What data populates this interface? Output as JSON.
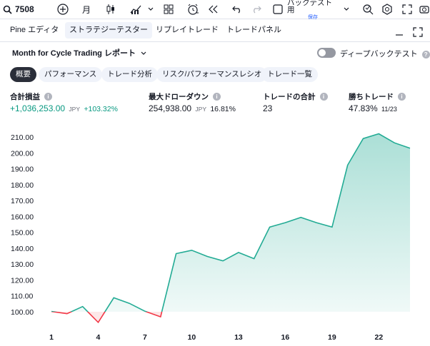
{
  "toolbar": {
    "symbol": "7508",
    "interval": "月",
    "layout_name": "バックテスト用",
    "save_state": "保存"
  },
  "tabs": [
    {
      "label": "Pine エディタ"
    },
    {
      "label": "ストラテジーテスター"
    },
    {
      "label": "リプレイトレード"
    },
    {
      "label": "トレードパネル"
    }
  ],
  "report": {
    "title": "Month for Cycle Trading レポート",
    "deep_backtest_label": "ディープバックテスト"
  },
  "subtabs": [
    {
      "label": "概要"
    },
    {
      "label": "パフォーマンス"
    },
    {
      "label": "トレード分析"
    },
    {
      "label": "リスク/パフォーマンスレシオ"
    },
    {
      "label": "トレード一覧"
    }
  ],
  "stats": {
    "net_profit": {
      "label": "合計損益",
      "value": "+1,036,253.00",
      "unit": "JPY",
      "pct": "+103.32%"
    },
    "max_drawdown": {
      "label": "最大ドローダウン",
      "value": "254,938.00",
      "unit": "JPY",
      "pct": "16.81%"
    },
    "total_trades": {
      "label": "トレードの合計",
      "value": "23"
    },
    "win_rate": {
      "label": "勝ちトレード",
      "value": "47.83%",
      "detail": "11/23"
    }
  },
  "colors": {
    "accent_green": "#089981",
    "line_green": "#22ab94",
    "loss_red": "#f23645"
  },
  "chart_data": {
    "type": "area",
    "baseline": 100,
    "x": [
      1,
      2,
      3,
      4,
      5,
      6,
      7,
      8,
      9,
      10,
      11,
      12,
      13,
      14,
      15,
      16,
      17,
      18,
      19,
      20,
      21,
      22,
      23
    ],
    "values": [
      100.2,
      98.8,
      103.3,
      93.3,
      108.8,
      105.3,
      100.3,
      96.8,
      136.6,
      138.7,
      134.8,
      132.0,
      137.3,
      133.4,
      153.3,
      156.1,
      159.4,
      156.1,
      153.3,
      192.3,
      209.0,
      212.0,
      206.3,
      202.9
    ],
    "xticks": [
      1,
      4,
      7,
      10,
      13,
      16,
      19,
      22
    ],
    "yticks": [
      "100.00",
      "110.00",
      "120.00",
      "130.00",
      "140.00",
      "150.00",
      "160.00",
      "170.00",
      "180.00",
      "190.00",
      "200.00",
      "210.00"
    ],
    "ylim": [
      95,
      215
    ]
  }
}
